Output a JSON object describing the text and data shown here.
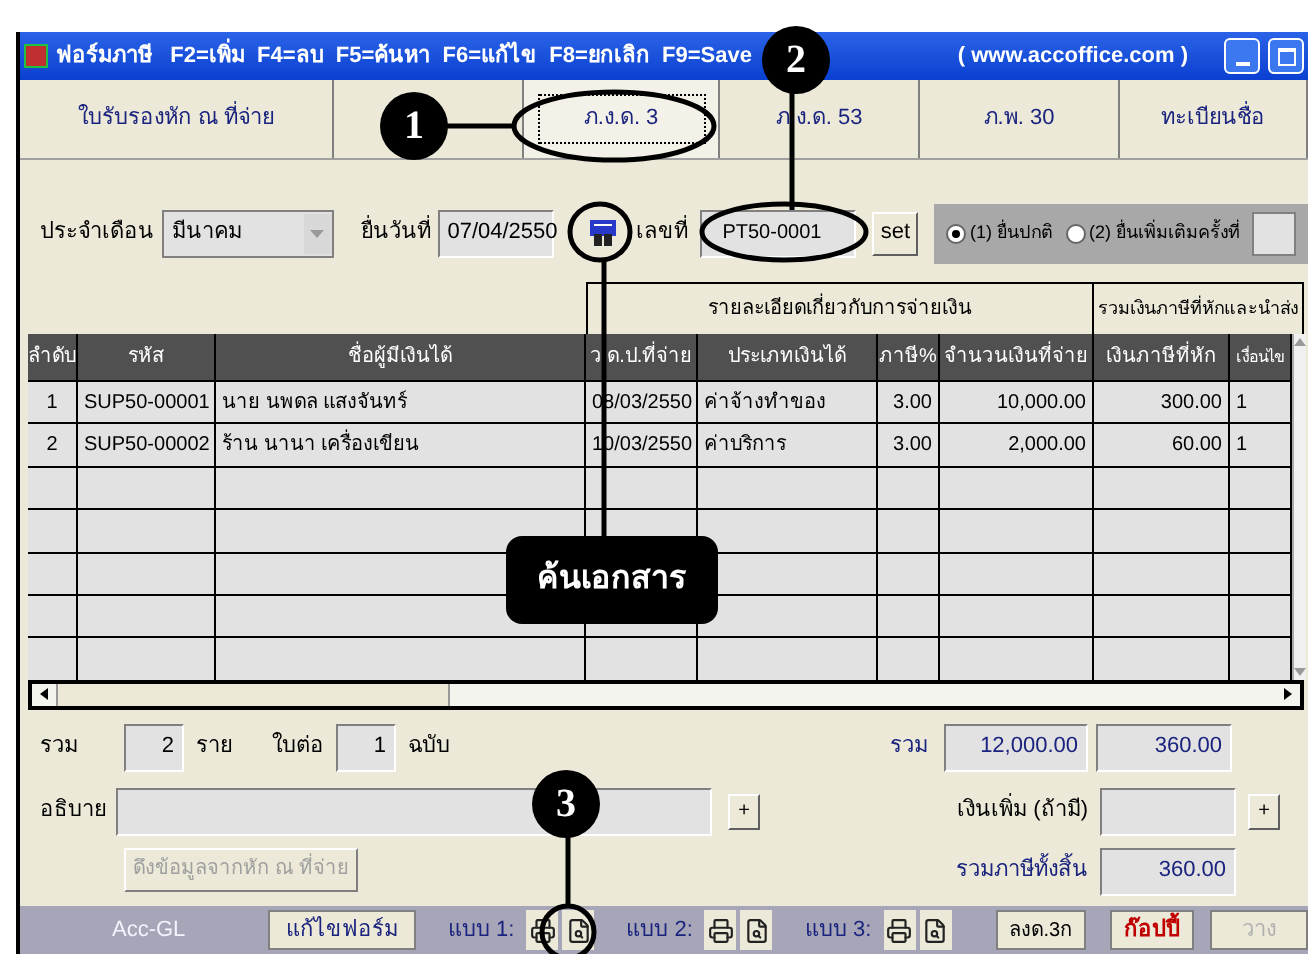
{
  "window": {
    "title": "ฟอร์มภาษี   F2=เพิ่ม  F4=ลบ  F5=ค้นหา  F6=แก้ไข  F8=ยกเลิก  F9=Save",
    "site": "( www.accoffice.com )"
  },
  "tabs": [
    {
      "label": "ใบรับรองหัก ณ ที่จ่าย",
      "selected": false
    },
    {
      "label": "ภ.ง.ด. 3",
      "selected": true
    },
    {
      "label": "ภ.ง.ด. 53",
      "selected": false
    },
    {
      "label": "ภ.พ. 30",
      "selected": false
    },
    {
      "label": "ทะเบียนชื่อ",
      "selected": false
    }
  ],
  "form": {
    "month_label": "ประจำเดือน",
    "month": "มีนาคม",
    "date_label": "ยื่นวันที่",
    "date": "07/04/2550",
    "number_label": "เลขที่",
    "number": "PT50-0001",
    "set_button": "set",
    "filing": [
      {
        "label": "(1) ยื่นปกติ",
        "selected": true
      },
      {
        "label": "(2) ยื่นเพิ่มเติมครั้งที่",
        "selected": false
      }
    ]
  },
  "table": {
    "groups": [
      "รายละเอียดเกี่ยวกับการจ่ายเงิน",
      "รวมเงินภาษีที่หักและนำส่ง"
    ],
    "columns": [
      "ลำดับ",
      "รหัส",
      "ชื่อผู้มีเงินได้",
      "ว.ด.ป.ที่จ่าย",
      "ประเภทเงินได้",
      "ภาษี%",
      "จำนวนเงินที่จ่าย",
      "เงินภาษีที่หัก",
      "เงื่อนไข"
    ],
    "rows": [
      [
        "1",
        "SUP50-00001",
        "นาย  นพดล แสงจันทร์",
        "08/03/2550",
        "ค่าจ้างทำของ",
        "3.00",
        "10,000.00",
        "300.00",
        "1"
      ],
      [
        "2",
        "SUP50-00002",
        "ร้าน  นานา เครื่องเขียน",
        "10/03/2550",
        "ค่าบริการ",
        "3.00",
        "2,000.00",
        "60.00",
        "1"
      ]
    ]
  },
  "summary": {
    "total_label": "รวม",
    "count": "2",
    "count_unit": "ราย",
    "sheets_label": "ใบต่อ",
    "sheets": "1",
    "sheets_unit": "ฉบับ",
    "sum_label": "รวม",
    "sum_paid": "12,000.00",
    "sum_tax": "360.00",
    "note_label": "อธิบาย",
    "extra_label": "เงินเพิ่ม (ถ้ามี)",
    "grand_label": "รวมภาษีทั้งสิ้น",
    "grand_total": "360.00",
    "pull_button": "ดึงข้อมูลจากหัก ณ ที่จ่าย",
    "plus": "+"
  },
  "toolbar": {
    "app": "Acc-GL",
    "edit_form": "แก้ไขฟอร์ม",
    "forms": [
      "แบบ 1:",
      "แบบ 2:",
      "แบบ 3:"
    ],
    "attach": "ลงด.3ก",
    "copy": "ก๊อปปี้",
    "paste": "วาง"
  },
  "annotations": [
    "1",
    "2",
    "3"
  ],
  "callout": "ค้นเอกสาร"
}
